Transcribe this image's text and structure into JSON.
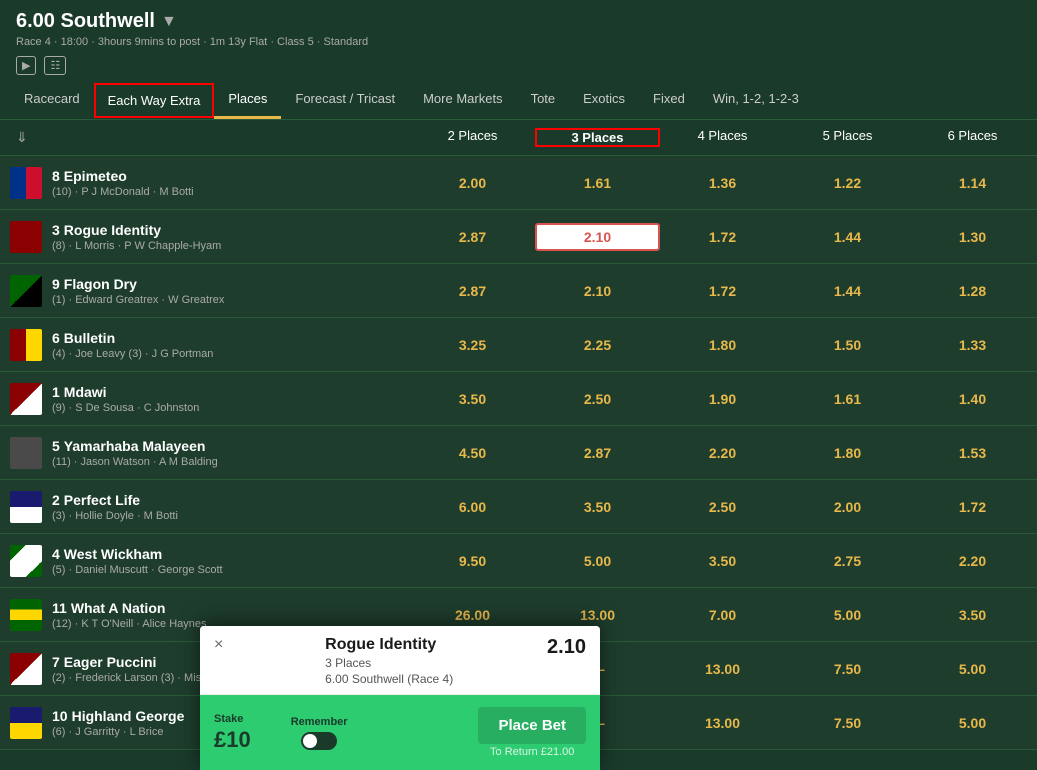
{
  "header": {
    "title": "6.00 Southwell",
    "race_info": "Race 4 · 18:00 · 3hours 9mins to post · 1m 13y Flat · Class 5 · Standard"
  },
  "tabs": [
    {
      "id": "racecard",
      "label": "Racecard",
      "active": false
    },
    {
      "id": "each-way-extra",
      "label": "Each Way Extra",
      "active": false,
      "highlighted": true
    },
    {
      "id": "places",
      "label": "Places",
      "active": true
    },
    {
      "id": "forecast-tricast",
      "label": "Forecast / Tricast",
      "active": false
    },
    {
      "id": "more-markets",
      "label": "More Markets",
      "active": false
    },
    {
      "id": "tote",
      "label": "Tote",
      "active": false
    },
    {
      "id": "exotics",
      "label": "Exotics",
      "active": false
    },
    {
      "id": "fixed",
      "label": "Fixed",
      "active": false
    },
    {
      "id": "win-123",
      "label": "Win, 1-2, 1-2-3",
      "active": false
    }
  ],
  "columns": {
    "horse": "",
    "places_2": "2 Places",
    "places_3": "3 Places",
    "places_4": "4 Places",
    "places_5": "5 Places",
    "places_6": "6 Places"
  },
  "horses": [
    {
      "number": "8",
      "name": "Epimeteo",
      "meta": "(10) · P J McDonald · M Botti",
      "silk_class": "silk-8",
      "odds": [
        "2.00",
        "1.61",
        "1.36",
        "1.22",
        "1.14"
      ]
    },
    {
      "number": "3",
      "name": "Rogue Identity",
      "meta": "(8) · L Morris · P W Chapple-Hyam",
      "silk_class": "silk-3",
      "odds": [
        "2.87",
        "2.10",
        "1.72",
        "1.44",
        "1.30"
      ],
      "selected_col": 1
    },
    {
      "number": "9",
      "name": "Flagon Dry",
      "meta": "(1) · Edward Greatrex · W Greatrex",
      "silk_class": "silk-9",
      "odds": [
        "2.87",
        "2.10",
        "1.72",
        "1.44",
        "1.28"
      ]
    },
    {
      "number": "6",
      "name": "Bulletin",
      "meta": "(4) · Joe Leavy (3) · J G Portman",
      "silk_class": "silk-6",
      "odds": [
        "3.25",
        "2.25",
        "1.80",
        "1.50",
        "1.33"
      ]
    },
    {
      "number": "1",
      "name": "Mdawi",
      "meta": "(9) · S De Sousa · C Johnston",
      "silk_class": "silk-1",
      "odds": [
        "3.50",
        "2.50",
        "1.90",
        "1.61",
        "1.40"
      ]
    },
    {
      "number": "5",
      "name": "Yamarhaba Malayeen",
      "meta": "(11) · Jason Watson · A M Balding",
      "silk_class": "silk-5",
      "odds": [
        "4.50",
        "2.87",
        "2.20",
        "1.80",
        "1.53"
      ]
    },
    {
      "number": "2",
      "name": "Perfect Life",
      "meta": "(3) · Hollie Doyle · M Botti",
      "silk_class": "silk-2",
      "odds": [
        "6.00",
        "3.50",
        "2.50",
        "2.00",
        "1.72"
      ]
    },
    {
      "number": "4",
      "name": "West Wickham",
      "meta": "(5) · Daniel Muscutt · George Scott",
      "silk_class": "silk-4",
      "odds": [
        "9.50",
        "5.00",
        "3.50",
        "2.75",
        "2.20"
      ]
    },
    {
      "number": "11",
      "name": "What A Nation",
      "meta": "(12) · K T O'Neill · Alice Haynes",
      "silk_class": "silk-7",
      "odds": [
        "26.00",
        "13.00",
        "7.00",
        "5.00",
        "3.50"
      ]
    },
    {
      "number": "7",
      "name": "Eager Puccini",
      "meta": "(2) · Frederick Larson (3) · Miss ...",
      "silk_class": "silk-1",
      "odds": [
        "—",
        "—",
        "13.00",
        "7.50",
        "5.00"
      ]
    },
    {
      "number": "10",
      "name": "Highland George",
      "meta": "(6) · J Garritty · L Brice",
      "silk_class": "silk-10",
      "odds": [
        "—",
        "—",
        "13.00",
        "7.50",
        "5.00"
      ]
    }
  ],
  "bet_popup": {
    "close_icon": "×",
    "horse_name": "Rogue Identity",
    "odds": "2.10",
    "bet_type": "3 Places",
    "race": "6.00 Southwell (Race 4)",
    "stake_label": "Stake",
    "stake_value": "£10",
    "remember_label": "Remember",
    "place_bet_label": "Place Bet",
    "return_label": "To Return £21.00"
  }
}
